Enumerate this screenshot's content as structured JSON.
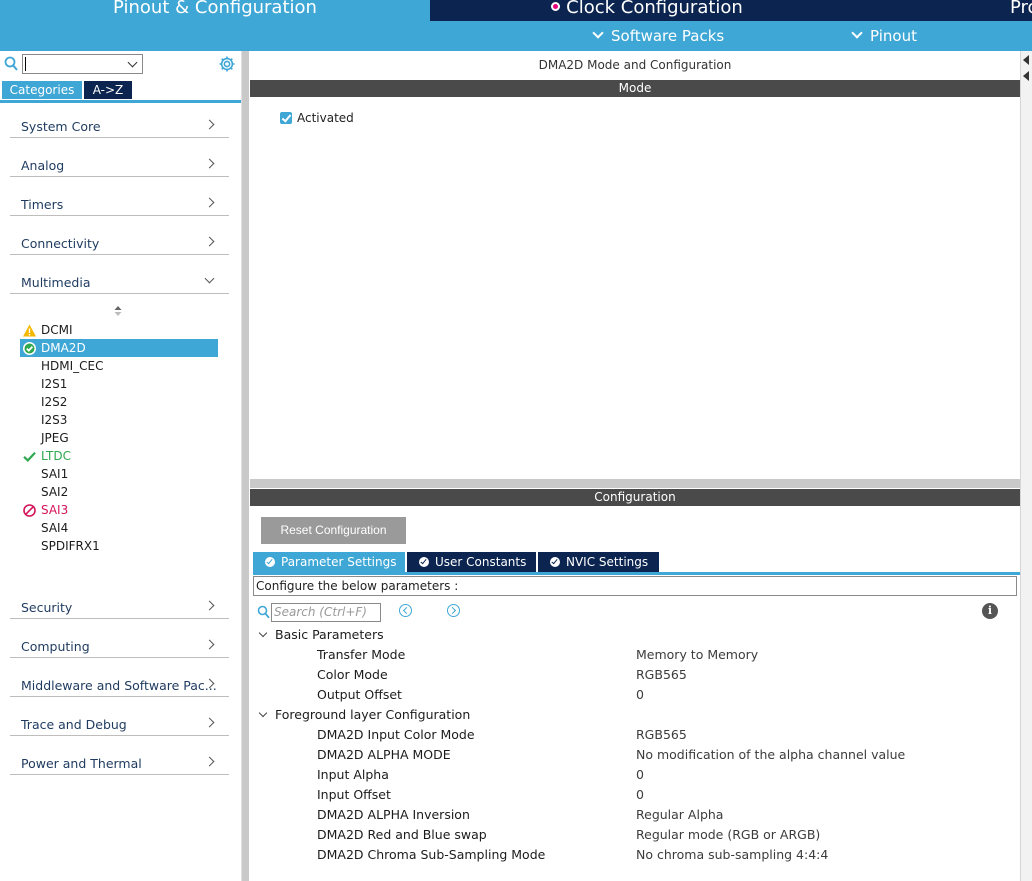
{
  "top_tabs": {
    "pinout_config": "Pinout & Configuration",
    "clock_config": "Clock Configuration",
    "project_partial": "Pro"
  },
  "sub_bar": {
    "software_packs": "Software Packs",
    "pinout": "Pinout"
  },
  "sidebar": {
    "search_value": "",
    "tabs": {
      "categories": "Categories",
      "az": "A->Z"
    },
    "categories": [
      {
        "label": "System Core"
      },
      {
        "label": "Analog"
      },
      {
        "label": "Timers"
      },
      {
        "label": "Connectivity"
      },
      {
        "label": "Multimedia"
      },
      {
        "label": "Security"
      },
      {
        "label": "Computing"
      },
      {
        "label": "Middleware and Software Pac..."
      },
      {
        "label": "Trace and Debug"
      },
      {
        "label": "Power and Thermal"
      }
    ],
    "multimedia_items": [
      {
        "name": "DCMI",
        "status": "warning"
      },
      {
        "name": "DMA2D",
        "status": "selected"
      },
      {
        "name": "HDMI_CEC",
        "status": "none"
      },
      {
        "name": "I2S1",
        "status": "none"
      },
      {
        "name": "I2S2",
        "status": "none"
      },
      {
        "name": "I2S3",
        "status": "none"
      },
      {
        "name": "JPEG",
        "status": "none"
      },
      {
        "name": "LTDC",
        "status": "ok"
      },
      {
        "name": "SAI1",
        "status": "none"
      },
      {
        "name": "SAI2",
        "status": "none"
      },
      {
        "name": "SAI3",
        "status": "blocked"
      },
      {
        "name": "SAI4",
        "status": "none"
      },
      {
        "name": "SPDIFRX1",
        "status": "none"
      }
    ]
  },
  "mode_panel": {
    "title": "DMA2D Mode and Configuration",
    "mode_header": "Mode",
    "activated_label": "Activated",
    "activated": true
  },
  "config_panel": {
    "header": "Configuration",
    "reset_button": "Reset Configuration",
    "tabs": [
      {
        "label": "Parameter Settings",
        "active": true
      },
      {
        "label": "User Constants",
        "active": false
      },
      {
        "label": "NVIC Settings",
        "active": false
      }
    ],
    "description": "Configure the below parameters :",
    "search_placeholder": "Search (Ctrl+F)",
    "groups": [
      {
        "name": "Basic Parameters",
        "params": [
          {
            "name": "Transfer Mode",
            "value": "Memory to Memory"
          },
          {
            "name": "Color Mode",
            "value": "RGB565"
          },
          {
            "name": "Output Offset",
            "value": "0"
          }
        ]
      },
      {
        "name": "Foreground layer Configuration",
        "params": [
          {
            "name": "DMA2D Input Color Mode",
            "value": "RGB565"
          },
          {
            "name": "DMA2D ALPHA MODE",
            "value": "No modification of the alpha channel value"
          },
          {
            "name": "Input Alpha",
            "value": "0"
          },
          {
            "name": "Input Offset",
            "value": "0"
          },
          {
            "name": "DMA2D ALPHA Inversion",
            "value": "Regular Alpha"
          },
          {
            "name": "DMA2D Red and Blue swap",
            "value": "Regular mode (RGB or ARGB)"
          },
          {
            "name": "DMA2D Chroma Sub-Sampling Mode",
            "value": "No chroma sub-sampling 4:4:4"
          }
        ]
      }
    ]
  },
  "colors": {
    "accent_blue": "#3fa7d6",
    "navy": "#0b2550",
    "ok_green": "#2fa84f",
    "warning_yellow": "#f5b800",
    "blocked_magenta": "#d4145a"
  }
}
